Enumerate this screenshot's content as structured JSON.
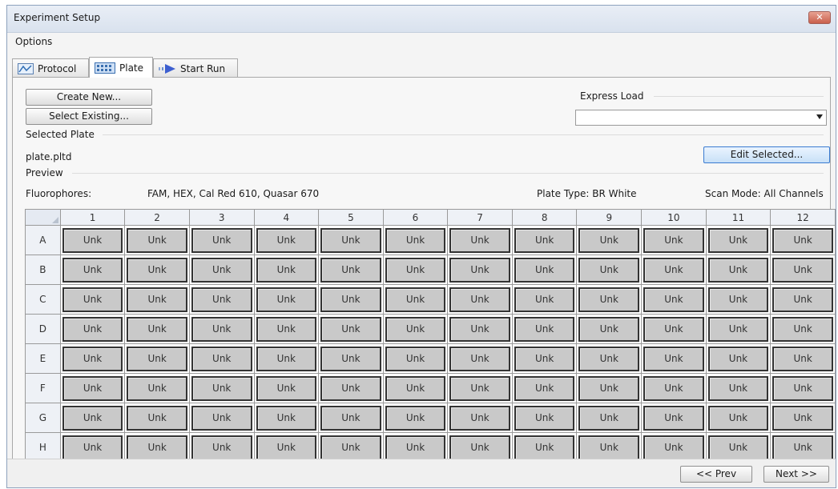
{
  "window": {
    "title": "Experiment Setup",
    "close_label": "✕"
  },
  "menu": {
    "items": [
      "Options"
    ]
  },
  "tabs": [
    {
      "label": "Protocol",
      "icon": "protocol-chart-icon"
    },
    {
      "label": "Plate",
      "icon": "plate-grid-icon",
      "active": true
    },
    {
      "label": "Start Run",
      "icon": "start-run-arrow-icon"
    }
  ],
  "buttons": {
    "create_new": "Create New...",
    "select_existing": "Select Existing...",
    "edit_selected": "Edit Selected...",
    "prev": "<< Prev",
    "next": "Next >>"
  },
  "express_load": {
    "label": "Express Load",
    "value": ""
  },
  "selected_plate": {
    "label": "Selected Plate",
    "file": "plate.pltd"
  },
  "preview": {
    "label": "Preview",
    "fluorophores_label": "Fluorophores:",
    "fluorophores_value": "FAM, HEX, Cal Red 610, Quasar 670",
    "plate_type": "Plate Type: BR White",
    "scan_mode": "Scan Mode: All Channels"
  },
  "plate": {
    "columns": [
      "1",
      "2",
      "3",
      "4",
      "5",
      "6",
      "7",
      "8",
      "9",
      "10",
      "11",
      "12"
    ],
    "rows": [
      "A",
      "B",
      "C",
      "D",
      "E",
      "F",
      "G",
      "H"
    ],
    "well_label": "Unk"
  },
  "colors": {
    "accent": "#3a7bd1",
    "well_fill": "#c9c9c9",
    "header_fill": "#eef1f6"
  }
}
